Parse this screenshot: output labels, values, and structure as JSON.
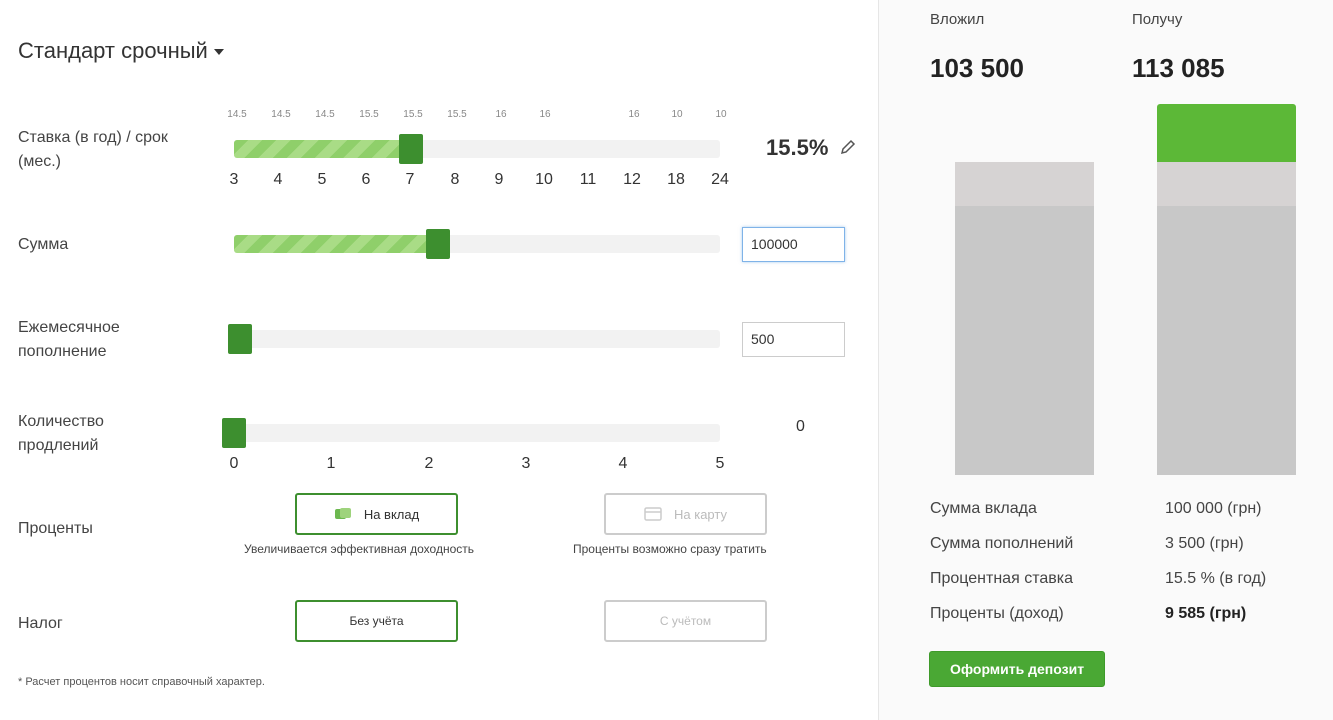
{
  "product": {
    "title": "Стандарт срочный"
  },
  "rate_row": {
    "label": "Ставка (в год) / срок (мес.)",
    "rates": [
      "14.5",
      "14.5",
      "14.5",
      "15.5",
      "15.5",
      "15.5",
      "16",
      "16",
      "16",
      "10",
      "10"
    ],
    "terms": [
      "3",
      "4",
      "5",
      "6",
      "7",
      "8",
      "9",
      "10",
      "11",
      "12",
      "18",
      "24"
    ],
    "selected_term": "7",
    "value": "15.5%"
  },
  "sum_row": {
    "label": "Сумма",
    "value": "100000",
    "fill_fraction": 0.42
  },
  "monthly_row": {
    "label": "Ежемесячное пополнение",
    "value": "500",
    "fill_fraction": 0
  },
  "extensions_row": {
    "label": "Количество продлений",
    "ticks": [
      "0",
      "1",
      "2",
      "3",
      "4",
      "5"
    ],
    "value": "0"
  },
  "interest_row": {
    "label": "Проценты",
    "option_deposit": "На вклад",
    "option_deposit_caption": "Увеличивается эффективная доходность",
    "option_card": "На карту",
    "option_card_caption": "Проценты возможно сразу тратить"
  },
  "tax_row": {
    "label": "Налог",
    "option_without": "Без учёта",
    "option_with": "С учётом"
  },
  "footnote": "* Расчет процентов носит справочный характер.",
  "summary": {
    "invested_label": "Вложил",
    "invested_value": "103 500",
    "receive_label": "Получу",
    "receive_value": "113 085",
    "rows": [
      {
        "label": "Сумма вклада",
        "value": "100 000 (грн)"
      },
      {
        "label": "Сумма пополнений",
        "value": "3 500 (грн)"
      },
      {
        "label": "Процентная ставка",
        "value": "15.5 % (в год)"
      },
      {
        "label": "Проценты (доход)",
        "value": "9 585 (грн)"
      }
    ],
    "submit_label": "Оформить депозит"
  },
  "colors": {
    "accent": "#3d8f2f",
    "button": "#4aa834",
    "bar_gray": "#c8c8c8",
    "bar_light": "#d6d3d3",
    "bar_green": "#5cb837"
  }
}
